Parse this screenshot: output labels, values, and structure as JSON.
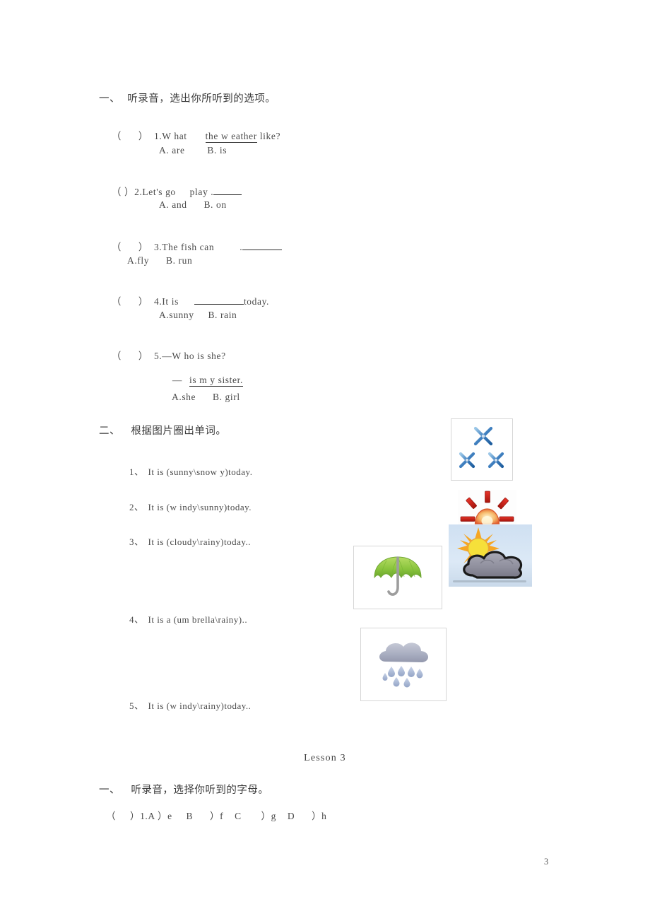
{
  "page": {
    "number": "3",
    "background": "#ffffff",
    "text_color": "#4a4a4a"
  },
  "section_one": {
    "heading": "一、  听录音，选出你所听到的选项。",
    "questions": [
      {
        "marker": "（      ）",
        "number": "1.",
        "stem_before": "W hat",
        "underlined": "the w eather",
        "stem_after": " like?",
        "options": "A. are        B. is"
      },
      {
        "marker": "（ ）",
        "number": "2.",
        "stem_before": "Let's go     play .",
        "underlined": "",
        "stem_after": "",
        "options": "A. and      B. on"
      },
      {
        "marker": "（      ）",
        "number": "3.",
        "stem_before": "The fish can",
        "underlined": "",
        "stem_after": ".",
        "options": "A.fly      B. run"
      },
      {
        "marker": "（      ）",
        "number": "4.",
        "stem_before": "It is",
        "underlined": "",
        "stem_after": "today.",
        "options": "A.sunny     B. rain"
      },
      {
        "marker": "（      ）",
        "number": "5.",
        "stem_before": "—W ho is she?",
        "answer_dash": "—",
        "answer_tail": "is m y sister.",
        "options": "A.she      B. girl"
      }
    ]
  },
  "section_two": {
    "heading": "二、   根据图片圈出单词。",
    "items": [
      {
        "number": "1、",
        "text": "It is (sunny\\snow y)today."
      },
      {
        "number": "2、",
        "text": "It is (w indy\\sunny)today."
      },
      {
        "number": "3、",
        "text": "It is (cloudy\\rainy)today.."
      },
      {
        "number": "4、",
        "text": "It is a (um brella\\rainy).."
      },
      {
        "number": "5、",
        "text": "It is (w indy\\rainy)today.."
      }
    ],
    "pictures": [
      {
        "name": "snowflakes-picture",
        "alt": "three blue snowflakes",
        "color": "#3f7fbf"
      },
      {
        "name": "sun-rays-picture",
        "alt": "red sun with rays",
        "color": "#d42a1e"
      },
      {
        "name": "sun-behind-cloud-picture",
        "alt": "yellow sun behind grey cloud",
        "color": "#8c8c9a"
      },
      {
        "name": "umbrella-picture",
        "alt": "green umbrella",
        "color": "#8cc63f"
      },
      {
        "name": "rain-cloud-picture",
        "alt": "grey cloud with blue raindrops",
        "color": "#a8aebe"
      }
    ]
  },
  "lesson_three": {
    "title": "Lesson 3",
    "heading": "一、   听录音，选择你听到的字母。",
    "question": "（     ）1.A ）e     B      ）f    C       ）g    D      ）h"
  }
}
